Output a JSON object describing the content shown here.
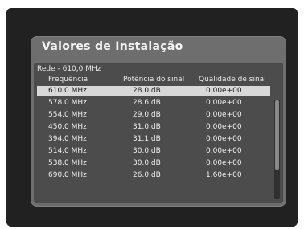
{
  "dialog": {
    "title": "Valores de Instalação",
    "network": "Rede - 610,0 MHz"
  },
  "columns": {
    "frequency": "Frequência",
    "power": "Potência do sinal",
    "quality": "Qualidade de sinal"
  },
  "rows": [
    {
      "frequency": "610.0 MHz",
      "power": "28.0 dB",
      "quality": "0.00e+00",
      "selected": true
    },
    {
      "frequency": "578.0 MHz",
      "power": "28.6 dB",
      "quality": "0.00e+00",
      "selected": false
    },
    {
      "frequency": "554.0 MHz",
      "power": "29.0 dB",
      "quality": "0.00e+00",
      "selected": false
    },
    {
      "frequency": "450.0 MHz",
      "power": "31.0 dB",
      "quality": "0.00e+00",
      "selected": false
    },
    {
      "frequency": "394.0 MHz",
      "power": "31.1 dB",
      "quality": "0.00e+00",
      "selected": false
    },
    {
      "frequency": "514.0 MHz",
      "power": "30.0 dB",
      "quality": "0.00e+00",
      "selected": false
    },
    {
      "frequency": "538.0 MHz",
      "power": "30.0 dB",
      "quality": "0.00e+00",
      "selected": false
    },
    {
      "frequency": "690.0 MHz",
      "power": "26.0 dB",
      "quality": "1.60e+00",
      "selected": false
    }
  ],
  "colors": {
    "screen": "#212121",
    "dialog": "#6e6e6e",
    "panel": "#4c4c4c",
    "selected_row": "#d8d8d8"
  }
}
